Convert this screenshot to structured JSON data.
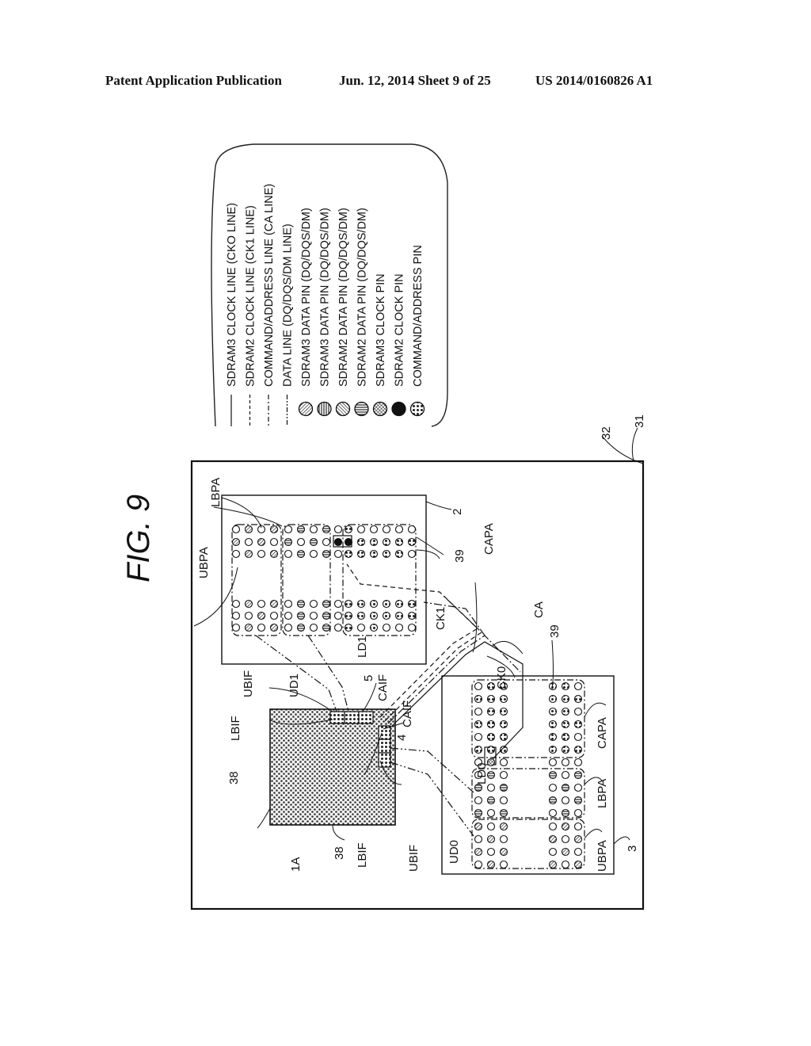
{
  "header": {
    "left": "Patent Application Publication",
    "middle": "Jun. 12, 2014  Sheet 9 of 25",
    "right": "US 2014/0160826 A1"
  },
  "figure": {
    "title": "FIG. 9",
    "orientation": "rotated 90 degrees counter-clockwise"
  },
  "legend": {
    "items": [
      {
        "symbol": "solid-line",
        "label": "SDRAM3 CLOCK LINE (CKO LINE)"
      },
      {
        "symbol": "dashed-line",
        "label": "SDRAM2 CLOCK LINE (CK1 LINE)"
      },
      {
        "symbol": "dash-dot-line",
        "label": "COMMAND/ADDRESS LINE (CA LINE)"
      },
      {
        "symbol": "dash-dot-dot-line",
        "label": "DATA LINE (DQ/DQS/DM LINE)"
      },
      {
        "symbol": "diagonal-hatch-circle",
        "label": "SDRAM3 DATA PIN (DQ/DQS/DM)"
      },
      {
        "symbol": "vertical-hatch-circle",
        "label": "SDRAM3 DATA PIN (DQ/DQS/DM)"
      },
      {
        "symbol": "reverse-diagonal-hatch-circle",
        "label": "SDRAM2 DATA PIN (DQ/DQS/DM)"
      },
      {
        "symbol": "horizontal-hatch-circle",
        "label": "SDRAM2 DATA PIN (DQ/DQS/DM)"
      },
      {
        "symbol": "cross-hatch-circle",
        "label": "SDRAM3 CLOCK PIN"
      },
      {
        "symbol": "filled-circle",
        "label": "SDRAM2 CLOCK PIN"
      },
      {
        "symbol": "dotted-circle",
        "label": "COMMAND/ADDRESS PIN"
      }
    ]
  },
  "labels": {
    "board_ref": "31",
    "board_surface": "32",
    "sdram_top": "2",
    "sdram_bottom": "3",
    "chip": "1A",
    "chip_fill_a": "38",
    "chip_fill_b": "38",
    "pin_top": "39",
    "pin_bottom": "39",
    "if_top": "5",
    "if_bottom": "4",
    "ubpa_top": "UBPA",
    "lbpa_top": "LBPA",
    "capa_top": "CAPA",
    "ubpa_bottom": "UBPA",
    "lbpa_bottom": "LBPA",
    "capa_bottom": "CAPA",
    "ubif_top": "UBIF",
    "lbif_top": "LBIF",
    "caif_top": "CAIF",
    "ubif_bottom": "UBIF",
    "lbif_bottom": "LBIF",
    "caif_bottom": "CAIF",
    "ud1": "UD1",
    "ld1": "LD1",
    "ud0": "UD0",
    "ld0": "LD0",
    "ck0": "CK0",
    "ck1": "CK1",
    "ca": "CA"
  }
}
